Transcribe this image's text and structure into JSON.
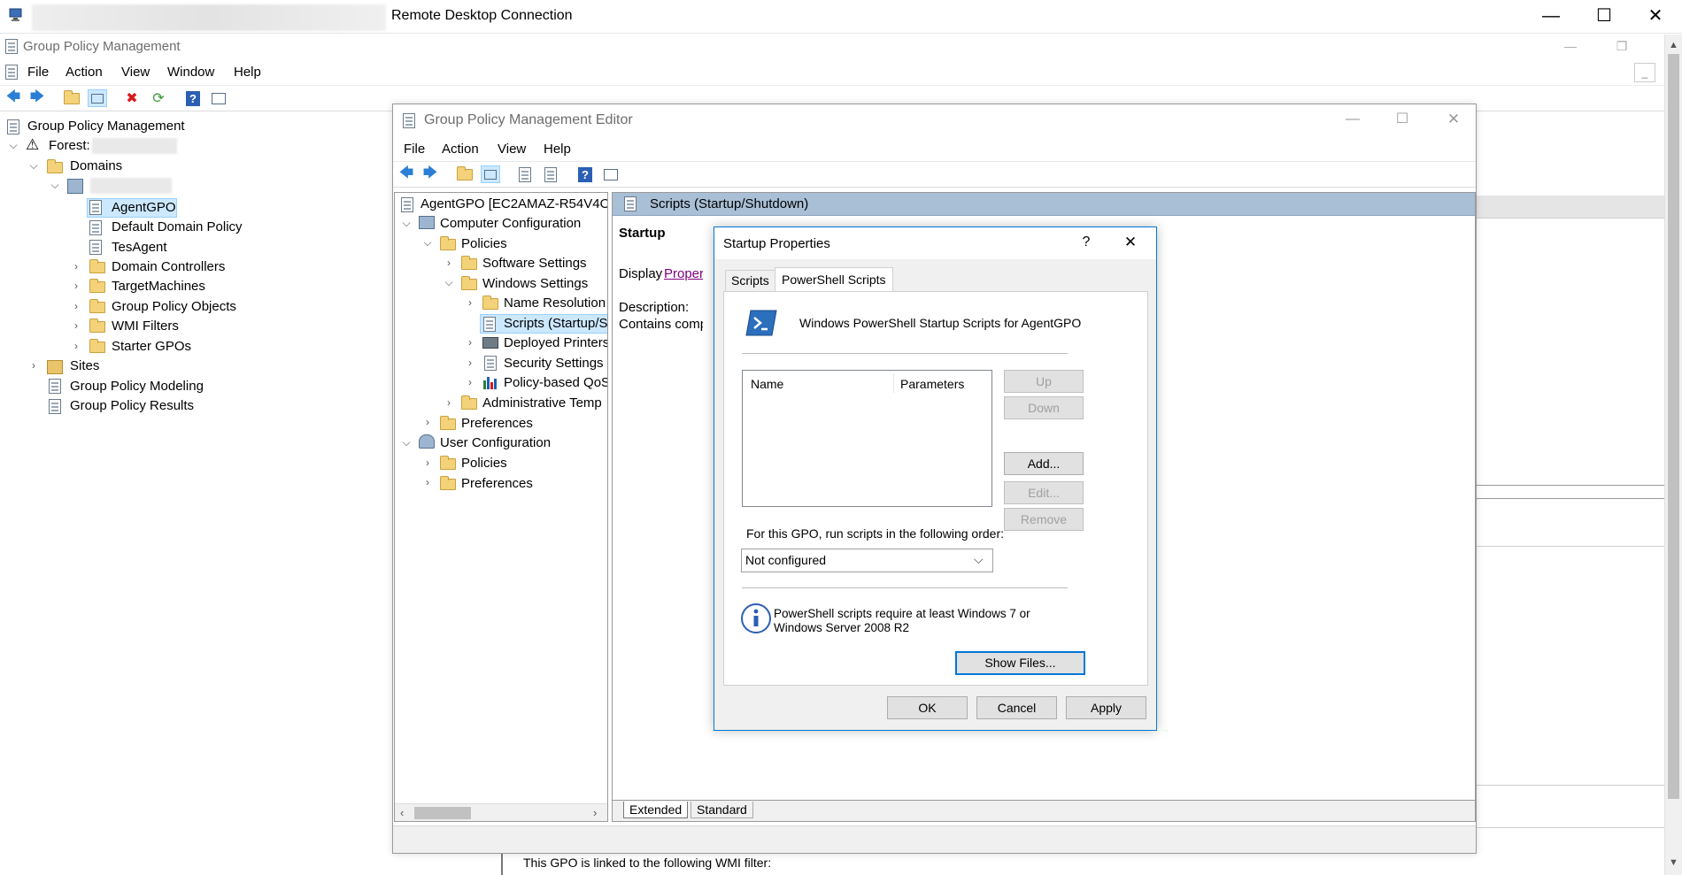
{
  "rdc": {
    "title": "Remote Desktop Connection"
  },
  "gpm": {
    "title": "Group Policy Management",
    "menu": [
      "File",
      "Action",
      "View",
      "Window",
      "Help"
    ],
    "tree": [
      {
        "label": "Group Policy Management"
      },
      {
        "label": "Forest:"
      },
      {
        "label": "Domains"
      },
      {
        "label": ""
      },
      {
        "label": "AgentGPO"
      },
      {
        "label": "Default Domain Policy"
      },
      {
        "label": "TesAgent"
      },
      {
        "label": "Domain Controllers"
      },
      {
        "label": "TargetMachines"
      },
      {
        "label": "Group Policy Objects"
      },
      {
        "label": "WMI Filters"
      },
      {
        "label": "Starter GPOs"
      },
      {
        "label": "Sites"
      },
      {
        "label": "Group Policy Modeling"
      },
      {
        "label": "Group Policy Results"
      }
    ],
    "wmi_text": "This GPO is linked to the following WMI filter:"
  },
  "editor": {
    "title": "Group Policy Management Editor",
    "menu": [
      "File",
      "Action",
      "View",
      "Help"
    ],
    "tree": [
      {
        "label": "AgentGPO [EC2AMAZ-R54V4O"
      },
      {
        "label": "Computer Configuration"
      },
      {
        "label": "Policies"
      },
      {
        "label": "Software Settings"
      },
      {
        "label": "Windows Settings"
      },
      {
        "label": "Name Resolution"
      },
      {
        "label": "Scripts (Startup/S"
      },
      {
        "label": "Deployed Printers"
      },
      {
        "label": "Security Settings"
      },
      {
        "label": "Policy-based QoS"
      },
      {
        "label": "Administrative Temp"
      },
      {
        "label": "Preferences"
      },
      {
        "label": "User Configuration"
      },
      {
        "label": "Policies"
      },
      {
        "label": "Preferences"
      }
    ],
    "right_header": "Scripts (Startup/Shutdown)",
    "startup_heading": "Startup",
    "display_label": "Display",
    "display_link": "Properties",
    "description_label": "Description:",
    "description_text": "Contains computer",
    "tabs": [
      "Extended",
      "Standard"
    ]
  },
  "dialog": {
    "title": "Startup Properties",
    "help": "?",
    "close": "✕",
    "tabs": [
      "Scripts",
      "PowerShell Scripts"
    ],
    "active_tab": "PowerShell Scripts",
    "heading": "Windows PowerShell Startup Scripts for AgentGPO",
    "columns": [
      "Name",
      "Parameters"
    ],
    "buttons": {
      "up": "Up",
      "down": "Down",
      "add": "Add...",
      "edit": "Edit...",
      "remove": "Remove"
    },
    "order_label": "For this GPO, run scripts in the following order:",
    "order_value": "Not configured",
    "info_text": "PowerShell scripts require at least Windows 7 or Windows Server 2008 R2",
    "show_files": "Show Files...",
    "ok": "OK",
    "cancel": "Cancel",
    "apply": "Apply"
  },
  "colors": {
    "accent": "#0078d7",
    "link": "#800080",
    "selection": "#cce8ff"
  }
}
